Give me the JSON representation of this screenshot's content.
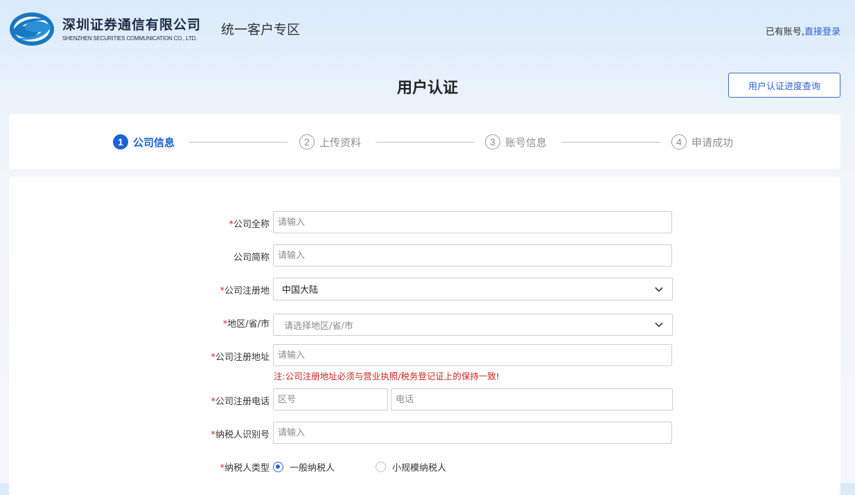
{
  "header": {
    "company_cn": "深圳证券通信有限公司",
    "company_en": "SHENZHEN SECURITIES COMMUNICATION CO., LTD.",
    "zone_title": "统一客户专区",
    "login_prompt": "已有账号,",
    "login_link": "直接登录"
  },
  "page": {
    "title": "用户认证",
    "progress_button": "用户认证进度查询"
  },
  "steps": [
    {
      "num": "1",
      "label": "公司信息",
      "state": "active"
    },
    {
      "num": "2",
      "label": "上传资料",
      "state": "inactive"
    },
    {
      "num": "3",
      "label": "账号信息",
      "state": "inactive"
    },
    {
      "num": "4",
      "label": "申请成功",
      "state": "inactive"
    }
  ],
  "form": {
    "required_mark": "*",
    "company_full_name": {
      "label": "公司全称",
      "placeholder": "请输入"
    },
    "company_short_name": {
      "label": "公司简称",
      "placeholder": "请输入"
    },
    "registration_place": {
      "label": "公司注册地",
      "value": "中国大陆"
    },
    "region": {
      "label": "地区/省/市",
      "placeholder": "请选择地区/省/市"
    },
    "registered_address": {
      "label": "公司注册地址",
      "placeholder": "请输入",
      "note": "注:公司注册地址必须与营业执照/税务登记证上的保持一致!"
    },
    "registered_phone": {
      "label": "公司注册电话",
      "area_placeholder": "区号",
      "phone_placeholder": "电话"
    },
    "taxpayer_id": {
      "label": "纳税人识别号",
      "placeholder": "请输入"
    },
    "taxpayer_type": {
      "label": "纳税人类型",
      "options": [
        "一般纳税人",
        "小规模纳税人"
      ],
      "selected": "一般纳税人"
    }
  },
  "colors": {
    "accent": "#1b63d4",
    "link": "#2a5fd2",
    "required": "#e02020",
    "note": "#c8281e"
  }
}
